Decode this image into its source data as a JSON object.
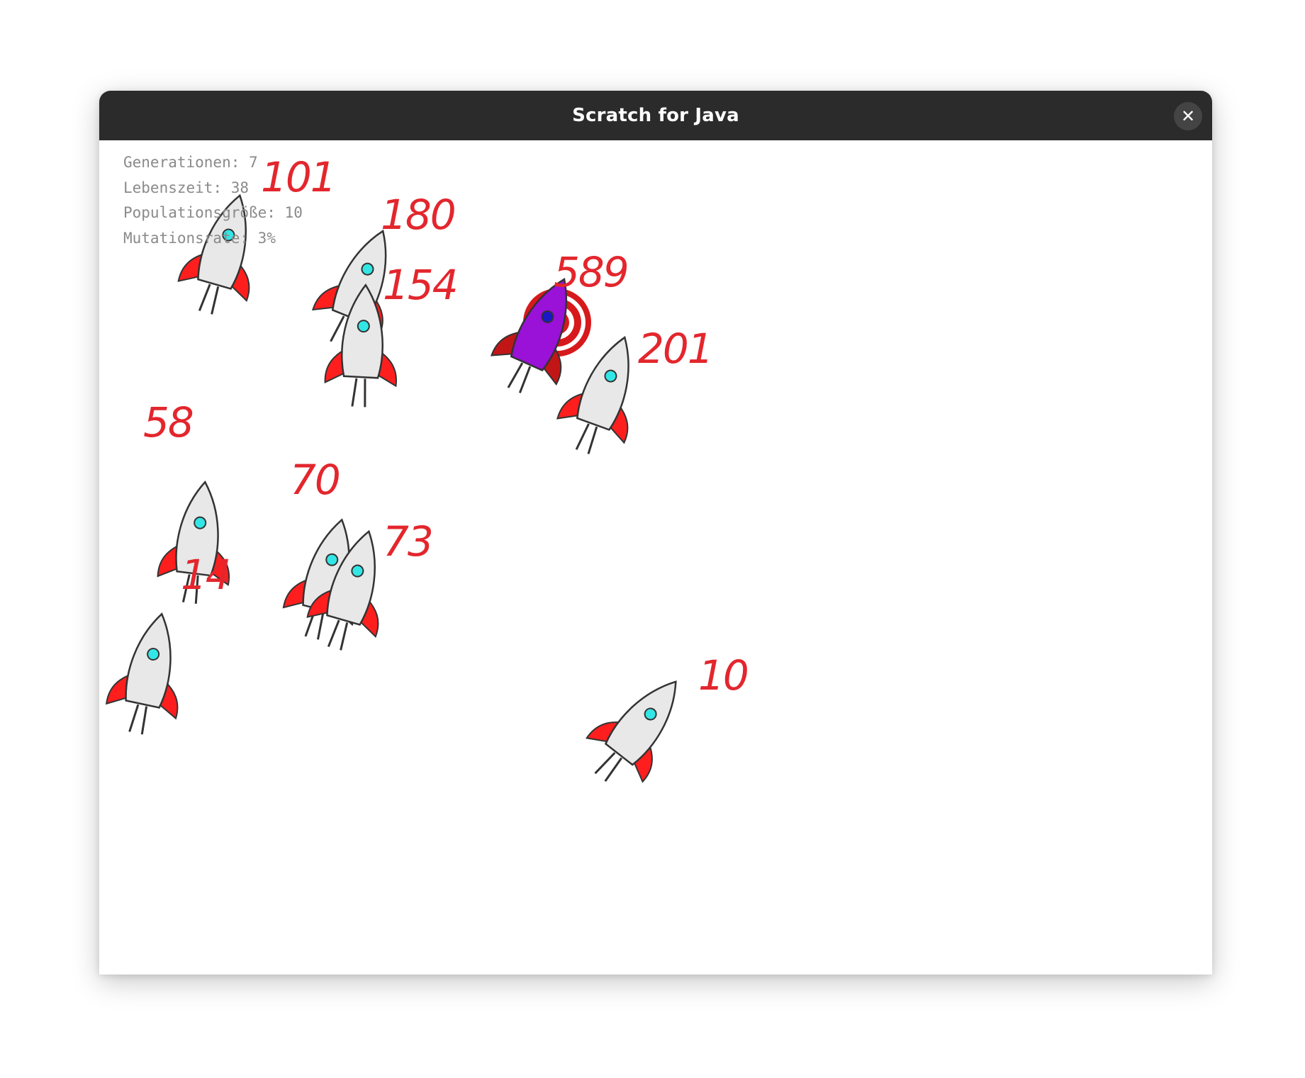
{
  "window": {
    "title": "Scratch for Java",
    "close_glyph": "✕"
  },
  "stats": [
    {
      "label": "Generationen",
      "value": "7"
    },
    {
      "label": "Lebenszeit",
      "value": "38"
    },
    {
      "label": "Populationsgröße",
      "value": "10"
    },
    {
      "label": "Mutationsrate",
      "value": "3%"
    }
  ],
  "target": {
    "icon": "target-icon",
    "color": "#d7191c"
  },
  "rockets": [
    {
      "score": "101",
      "best": false
    },
    {
      "score": "180",
      "best": false
    },
    {
      "score": "154",
      "best": false
    },
    {
      "score": "589",
      "best": true
    },
    {
      "score": "201",
      "best": false
    },
    {
      "score": "58",
      "best": false
    },
    {
      "score": "70",
      "best": false
    },
    {
      "score": "73",
      "best": false
    },
    {
      "score": "14",
      "best": false
    },
    {
      "score": "10",
      "best": false
    }
  ],
  "colors": {
    "rocket_body": "#e8e8e8",
    "rocket_best_body": "#9a11d8",
    "fin": "#ff1e1e",
    "fin_best": "#c21616",
    "window_porthole": "#33e6e6",
    "window_porthole_best": "#1a18c8",
    "score_text": "#e3262d",
    "titlebar": "#2b2b2b"
  }
}
